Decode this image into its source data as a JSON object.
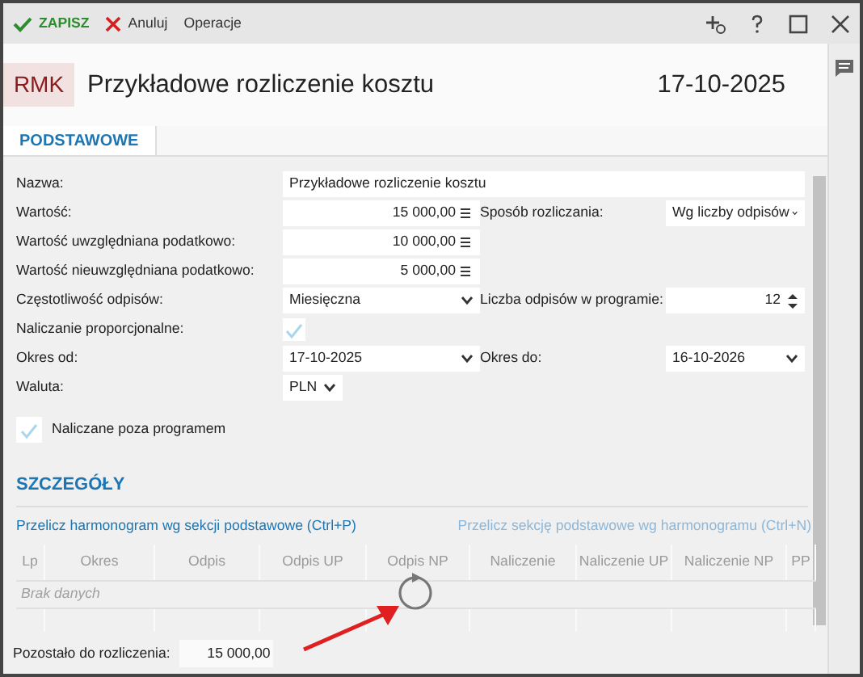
{
  "toolbar": {
    "actions": [
      {
        "label": "ZAPISZ",
        "kind": "save"
      },
      {
        "label": "Anuluj",
        "kind": "cancel"
      },
      {
        "label": "Operacje",
        "kind": "menu"
      }
    ]
  },
  "header": {
    "badge": "RMK",
    "title": "Przykładowe rozliczenie kosztu",
    "date": "17-10-2025"
  },
  "tabs": [
    {
      "label": "PODSTAWOWE",
      "selected": true
    }
  ],
  "rows": [
    {
      "fields": [
        {
          "label": "Nazwa:",
          "kind": "text",
          "value": "Przykładowe rozliczenie kosztu"
        }
      ]
    },
    {
      "fields": [
        {
          "label": "Wartość:",
          "kind": "amount",
          "value": "15 000,00"
        },
        {
          "label": "Sposób rozliczania:",
          "kind": "select",
          "value": "Wg liczby odpisów"
        }
      ]
    },
    {
      "fields": [
        {
          "label": "Wartość uwzględniana podatkowo:",
          "kind": "amount",
          "value": "10 000,00"
        }
      ]
    },
    {
      "fields": [
        {
          "label": "Wartość nieuwzględniana podatkowo:",
          "kind": "amount",
          "value": "5 000,00"
        }
      ]
    },
    {
      "fields": [
        {
          "label": "Częstotliwość odpisów:",
          "kind": "select",
          "value": "Miesięczna"
        },
        {
          "label": "Liczba odpisów w programie:",
          "kind": "spin",
          "value": "12"
        }
      ]
    },
    {
      "fields": [
        {
          "label": "Naliczanie proporcjonalne:",
          "kind": "check",
          "checked": true
        }
      ]
    },
    {
      "fields": [
        {
          "label": "Okres od:",
          "kind": "select",
          "value": "17-10-2025"
        },
        {
          "label": "Okres do:",
          "kind": "select",
          "value": "16-10-2026"
        }
      ]
    },
    {
      "fields": [
        {
          "label": "Waluta:",
          "kind": "short-select",
          "value": "PLN"
        }
      ]
    }
  ],
  "standalone_checkbox": {
    "label": "Naliczane poza programem",
    "checked": true
  },
  "details": {
    "heading": "SZCZEGÓŁY",
    "links": [
      {
        "label": "Przelicz harmonogram wg sekcji podstawowe (Ctrl+P)",
        "disabled": false
      },
      {
        "label": "Przelicz sekcję podstawowe wg harmonogramu (Ctrl+N)",
        "disabled": true
      }
    ],
    "table": {
      "columns": [
        "Lp",
        "Okres",
        "Odpis",
        "Odpis UP",
        "Odpis NP",
        "Naliczenie",
        "Naliczenie UP",
        "Naliczenie NP",
        "PP"
      ],
      "empty_message": "Brak danych"
    }
  },
  "remaining": {
    "label": "Pozostało do rozliczenia:",
    "value": "15 000,00"
  }
}
